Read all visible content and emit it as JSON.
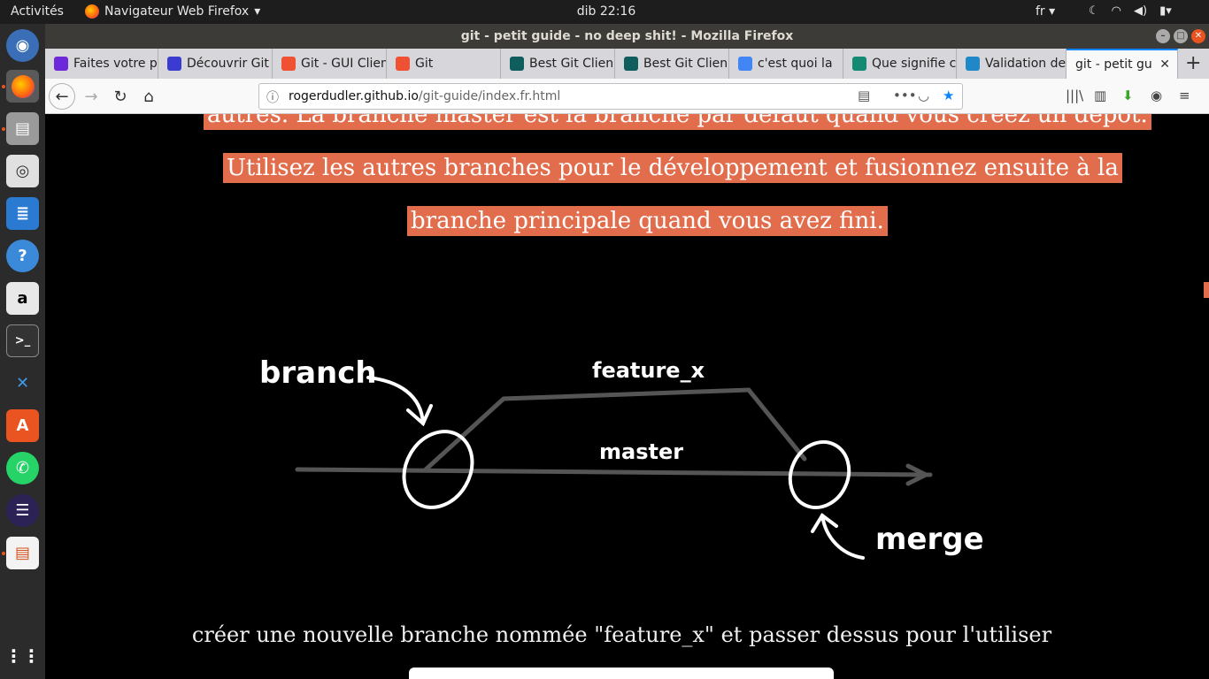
{
  "topbar": {
    "activities": "Activités",
    "app_menu": "Navigateur Web Firefox",
    "clock": "dib 22:16",
    "lang": "fr"
  },
  "window": {
    "title": "git - petit guide - no deep shit! - Mozilla Firefox"
  },
  "tabs": [
    {
      "label": "Faites votre p",
      "fav_color": "#6d28d9"
    },
    {
      "label": "Découvrir Git",
      "fav_color": "#3b3bd1"
    },
    {
      "label": "Git - GUI Clien",
      "fav_color": "#f05133"
    },
    {
      "label": "Git",
      "fav_color": "#f05133"
    },
    {
      "label": "Best Git Clien",
      "fav_color": "#0f5d5d"
    },
    {
      "label": "Best Git Clien",
      "fav_color": "#0f5d5d"
    },
    {
      "label": "c'est quoi la",
      "fav_color": "#4285f4"
    },
    {
      "label": "Que signifie c",
      "fav_color": "#138a72"
    },
    {
      "label": "Validation de",
      "fav_color": "#1e88c9"
    },
    {
      "label": "git - petit guid",
      "fav_color": "#ffffff"
    }
  ],
  "url": {
    "host": "rogerdudler.github.io",
    "path": "/git-guide/index.fr.html"
  },
  "content": {
    "line1": "autres. La branche master est la branche par défaut quand vous créez un dépôt.",
    "line2": "Utilisez les autres branches pour le développement et fusionnez ensuite à la",
    "line3": "branche principale quand vous avez fini.",
    "diagram": {
      "label_branch": "branch",
      "label_feature": "feature_x",
      "label_master": "master",
      "label_merge": "merge"
    },
    "caption": "créer une nouvelle branche nommée \"feature_x\" et passer dessus pour l'utiliser"
  }
}
